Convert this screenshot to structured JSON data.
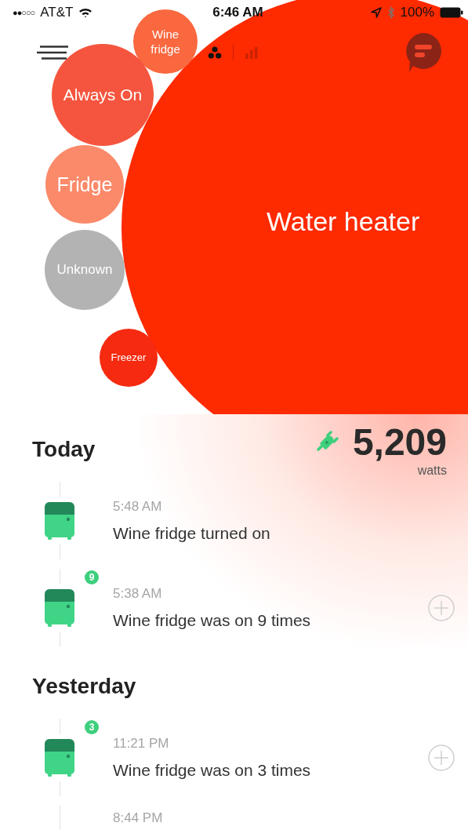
{
  "status_bar": {
    "signal_bars": "●●○○○",
    "carrier": "AT&T",
    "time": "6:46 AM",
    "battery": "100%"
  },
  "view_toggle": [
    {
      "kind": "bubbles",
      "selected": true
    },
    {
      "kind": "bars",
      "selected": false
    }
  ],
  "bubbles": [
    {
      "label": "Water heater",
      "color": "#fe2a00"
    },
    {
      "label": "Wine fridge",
      "color": "#f9683f"
    },
    {
      "label": "Always On",
      "color": "#f5553e"
    },
    {
      "label": "Fridge",
      "color": "#fb8a6a"
    },
    {
      "label": "Unknown",
      "color": "#b3b3b3"
    },
    {
      "label": "Freezer",
      "color": "#f52a10"
    }
  ],
  "power": {
    "value": "5,209",
    "unit": "watts"
  },
  "sections": [
    {
      "title": "Today",
      "events": [
        {
          "time": "5:48 AM",
          "text": "Wine fridge turned on"
        },
        {
          "time": "5:38 AM",
          "text": "Wine fridge was on 9 times",
          "count": "9",
          "expandable": true
        }
      ]
    },
    {
      "title": "Yesterday",
      "events": [
        {
          "time": "11:21 PM",
          "text": "Wine fridge was on 3 times",
          "count": "3",
          "expandable": true
        },
        {
          "time": "8:44 PM"
        }
      ]
    }
  ]
}
